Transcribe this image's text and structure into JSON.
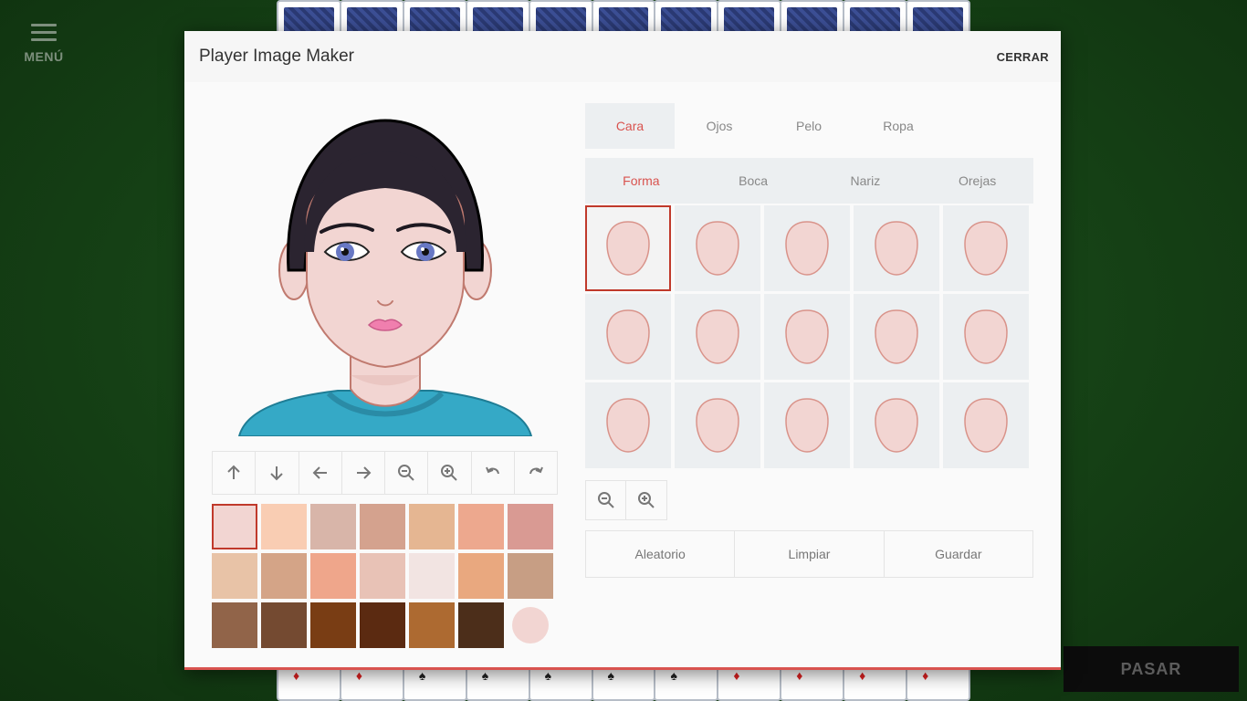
{
  "menu": {
    "label": "MENÚ",
    "icon": "hamburger-icon"
  },
  "pasar": {
    "label": "PASAR"
  },
  "dialog": {
    "title": "Player Image Maker",
    "close_label": "CERRAR"
  },
  "main_tabs": [
    {
      "label": "Cara",
      "active": true
    },
    {
      "label": "Ojos",
      "active": false
    },
    {
      "label": "Pelo",
      "active": false
    },
    {
      "label": "Ropa",
      "active": false
    }
  ],
  "sub_tabs": [
    {
      "label": "Forma",
      "active": true
    },
    {
      "label": "Boca",
      "active": false
    },
    {
      "label": "Nariz",
      "active": false
    },
    {
      "label": "Orejas",
      "active": false
    }
  ],
  "toolbar": [
    {
      "icon": "arrow-up-icon"
    },
    {
      "icon": "arrow-down-icon"
    },
    {
      "icon": "arrow-left-icon"
    },
    {
      "icon": "arrow-right-icon"
    },
    {
      "icon": "zoom-out-icon"
    },
    {
      "icon": "zoom-in-icon"
    },
    {
      "icon": "undo-icon"
    },
    {
      "icon": "redo-icon"
    }
  ],
  "skin_colors": [
    "#f2d5d2",
    "#f9cdb3",
    "#d8b5a9",
    "#d4a28e",
    "#e5b692",
    "#eda88e",
    "#d99a93",
    "#e8c3a7",
    "#d4a487",
    "#efa68b",
    "#e8c2b6",
    "#f2e4e2",
    "#e9a87f",
    "#c79e84",
    "#916449",
    "#744a31",
    "#793d14",
    "#5b2a11",
    "#ad6a31",
    "#4c2e1a"
  ],
  "selected_skin_index": 0,
  "custom_color": "#f2d5d2",
  "face_shape_selected_index": 0,
  "face_shape_count": 15,
  "zoom": [
    {
      "icon": "zoom-out-icon"
    },
    {
      "icon": "zoom-in-icon"
    }
  ],
  "actions": {
    "random": "Aleatorio",
    "clear": "Limpiar",
    "save": "Guardar"
  },
  "colors": {
    "accent": "#d9534f",
    "shirt": "#35a9c6",
    "hair": "#2b2430",
    "skin": "#f2d5d2",
    "eye": "#6878c4",
    "lips": "#f07fae"
  }
}
